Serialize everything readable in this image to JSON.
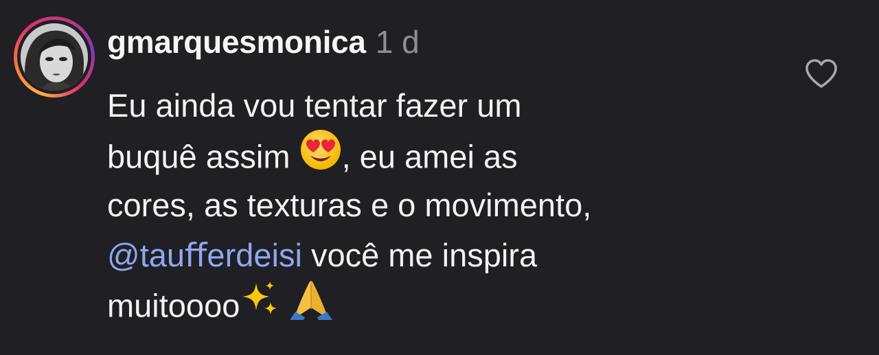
{
  "comment": {
    "username": "gmarquesmonica",
    "timestamp": "1 d",
    "like_icon": "heart-outline-icon",
    "avatar_ring_colors": [
      "#fcaf45",
      "#f77737",
      "#e1306c",
      "#c13584",
      "#833ab4"
    ],
    "mention_color": "#8fa7f0",
    "lines": {
      "l1": "Eu ainda vou tentar fazer um",
      "l2a": "buquê assim",
      "l2_emoji": "smiling-face-with-heart-eyes-emoji",
      "l2b": ", eu amei as",
      "l3": "cores, as texturas e o movimento,",
      "l4_mention": "@tauﬀerdeisi",
      "l4b": " você me inspira",
      "l5": "muitoooo",
      "l5_emoji1": "sparkles-emoji",
      "l5_emoji2": "folded-hands-emoji"
    }
  }
}
